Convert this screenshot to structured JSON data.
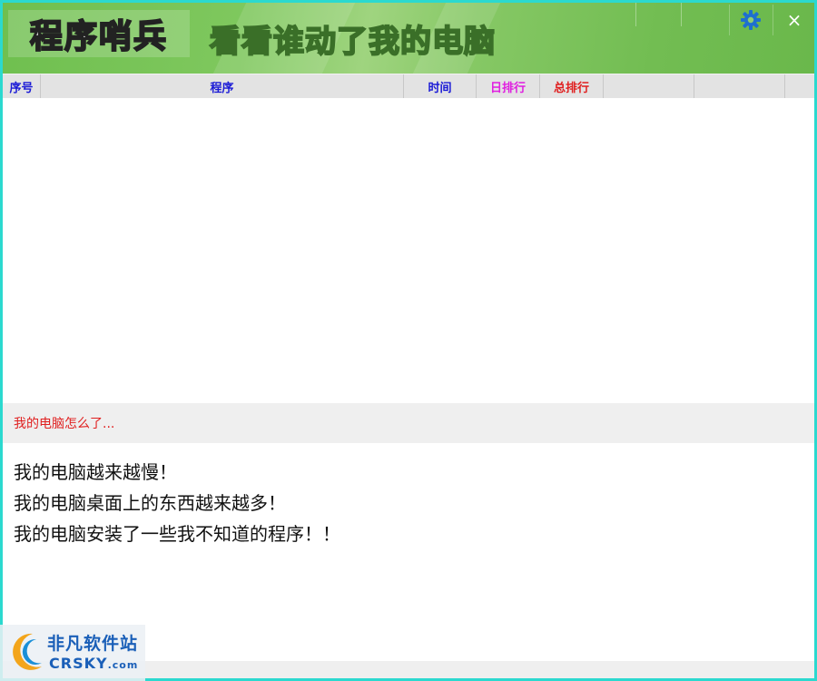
{
  "titlebar": {
    "app_name": "程序哨兵",
    "slogan": "看看谁动了我的电脑",
    "settings_icon": "gear-icon",
    "close_label": "×"
  },
  "table": {
    "columns": [
      {
        "label": "序号",
        "color": "#1a1ad6"
      },
      {
        "label": "程序",
        "color": "#1a1ad6"
      },
      {
        "label": "时间",
        "color": "#1a1ad6"
      },
      {
        "label": "日排行",
        "color": "#e020e0"
      },
      {
        "label": "总排行",
        "color": "#e02020"
      },
      {
        "label": "",
        "color": "#1a1ad6"
      },
      {
        "label": "",
        "color": "#1a1ad6"
      },
      {
        "label": "",
        "color": "#1a1ad6"
      }
    ],
    "rows": []
  },
  "info": {
    "header": "我的电脑怎么了...",
    "lines": [
      "我的电脑越来越慢！",
      "我的电脑桌面上的东西越来越多！",
      "我的电脑安装了一些我不知道的程序！！"
    ]
  },
  "watermark": {
    "cn": "非凡软件站",
    "en": "CRSKY",
    "en_suffix": ".com"
  },
  "colors": {
    "titlebar": "#7cc55b",
    "border": "#2bd9cf",
    "header_text_blue": "#1a1ad6",
    "day_rank": "#e020e0",
    "total_rank": "#e02020",
    "info_header_text": "#e02020",
    "gear": "#1e6fd0"
  }
}
